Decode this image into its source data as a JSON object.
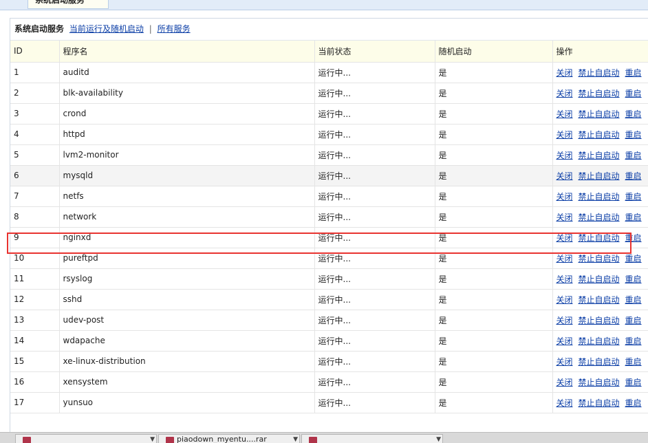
{
  "top_tab": {
    "label": "系统启动服务"
  },
  "header": {
    "title": "系统启动服务",
    "link_running": "当前运行及随机启动",
    "separator": "|",
    "link_all": "所有服务"
  },
  "table": {
    "columns": [
      "ID",
      "程序名",
      "当前状态",
      "随机启动",
      "操作"
    ],
    "actions": [
      "关闭",
      "禁止自启动",
      "重启"
    ],
    "rows": [
      {
        "id": "1",
        "name": "auditd",
        "status": "运行中...",
        "autostart": "是"
      },
      {
        "id": "2",
        "name": "blk-availability",
        "status": "运行中...",
        "autostart": "是"
      },
      {
        "id": "3",
        "name": "crond",
        "status": "运行中...",
        "autostart": "是"
      },
      {
        "id": "4",
        "name": "httpd",
        "status": "运行中...",
        "autostart": "是"
      },
      {
        "id": "5",
        "name": "lvm2-monitor",
        "status": "运行中...",
        "autostart": "是"
      },
      {
        "id": "6",
        "name": "mysqld",
        "status": "运行中...",
        "autostart": "是"
      },
      {
        "id": "7",
        "name": "netfs",
        "status": "运行中...",
        "autostart": "是"
      },
      {
        "id": "8",
        "name": "network",
        "status": "运行中...",
        "autostart": "是"
      },
      {
        "id": "9",
        "name": "nginxd",
        "status": "运行中...",
        "autostart": "是"
      },
      {
        "id": "10",
        "name": "pureftpd",
        "status": "运行中...",
        "autostart": "是"
      },
      {
        "id": "11",
        "name": "rsyslog",
        "status": "运行中...",
        "autostart": "是"
      },
      {
        "id": "12",
        "name": "sshd",
        "status": "运行中...",
        "autostart": "是"
      },
      {
        "id": "13",
        "name": "udev-post",
        "status": "运行中...",
        "autostart": "是"
      },
      {
        "id": "14",
        "name": "wdapache",
        "status": "运行中...",
        "autostart": "是"
      },
      {
        "id": "15",
        "name": "xe-linux-distribution",
        "status": "运行中...",
        "autostart": "是"
      },
      {
        "id": "16",
        "name": "xensystem",
        "status": "运行中...",
        "autostart": "是"
      },
      {
        "id": "17",
        "name": "yunsuo",
        "status": "运行中...",
        "autostart": "是"
      }
    ],
    "alt_row_index": 5,
    "highlight_row_index": 8
  },
  "highlight": {
    "color": "#e8322f"
  },
  "downloads": [
    {
      "name": ""
    },
    {
      "name": "piaodown_myentu....rar"
    },
    {
      "name": ""
    }
  ]
}
